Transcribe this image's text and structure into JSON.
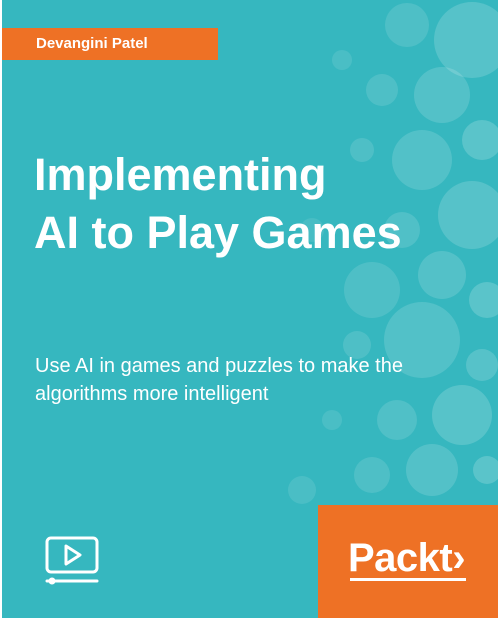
{
  "cover": {
    "author": "Devangini Patel",
    "title_lines": [
      "Implementing",
      "AI to Play Games"
    ],
    "subtitle_lines": [
      "Use AI in games and puzzles to make the",
      "algorithms more intelligent"
    ],
    "publisher": "Packt›",
    "icons": {
      "format": "video-play-icon",
      "decoration": "bokeh-circles"
    },
    "colors": {
      "background": "#36b7bf",
      "accent": "#ee7125",
      "text": "#ffffff"
    }
  }
}
